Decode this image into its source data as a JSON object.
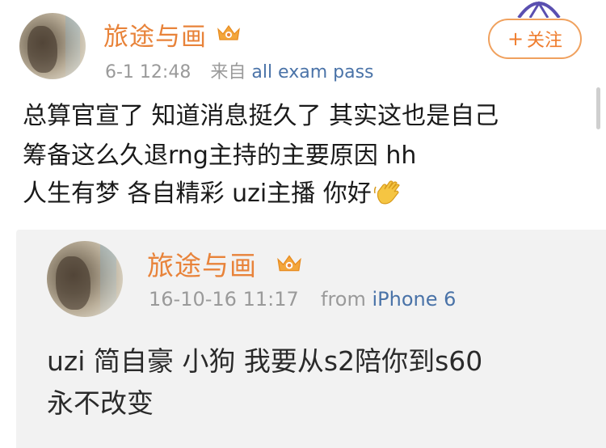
{
  "post": {
    "username": "旅途与画",
    "time": "6-1 12:48",
    "source_prefix": "来自",
    "source": "all exam pass",
    "follow_label": "关注",
    "follow_plus": "+",
    "lines": [
      "总算官宣了 知道消息挺久了 其实这也是自己",
      "筹备这么久退rng主持的主要原因 hh",
      "人生有梦 各自精彩 uzi主播 你好"
    ]
  },
  "quoted": {
    "username": "旅途与画",
    "time": "16-10-16 11:17",
    "source_prefix": "from",
    "source": "iPhone 6",
    "lines": [
      "uzi 简自豪 小狗 我要从s2陪你到s60 ",
      "永不改变"
    ]
  },
  "colors": {
    "name": "#e8833a",
    "link": "#4a73a8",
    "follow_border": "#f0a15e",
    "quote_bg": "#f2f2f2"
  },
  "icons": [
    "crown-badge-icon",
    "waving-hand-icon",
    "plus-icon"
  ]
}
